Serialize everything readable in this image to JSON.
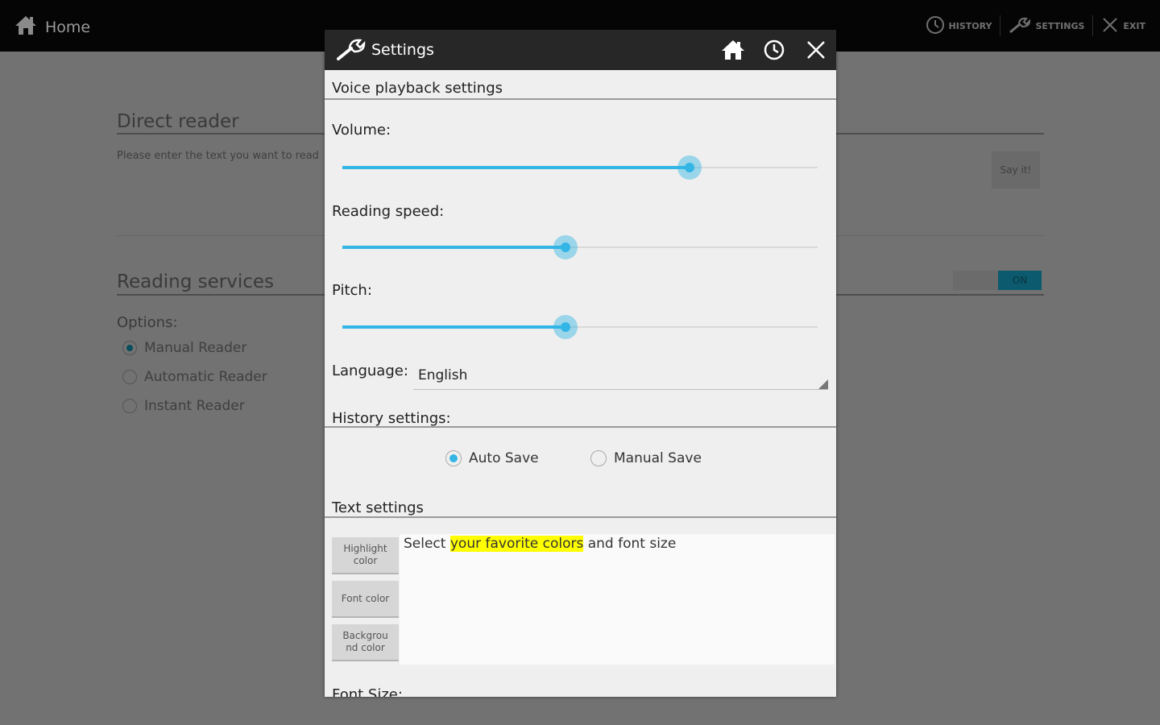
{
  "topbar": {
    "home_label": "Home",
    "actions": [
      {
        "label": "HISTORY",
        "icon": "clock-icon"
      },
      {
        "label": "SETTINGS",
        "icon": "wrench-icon"
      },
      {
        "label": "EXIT",
        "icon": "close-icon"
      }
    ]
  },
  "background": {
    "direct_reader": {
      "title": "Direct reader",
      "hint": "Please enter the text you want to read",
      "say_button": "Say it!"
    },
    "reading_services": {
      "title": "Reading services",
      "toggle": "ON",
      "options_label": "Options:",
      "options": [
        {
          "label": "Manual Reader",
          "selected": true
        },
        {
          "label": "Automatic Reader",
          "selected": false
        },
        {
          "label": "Instant Reader",
          "selected": false
        }
      ]
    }
  },
  "dialog": {
    "title": "Settings",
    "header_icons": [
      "home-icon",
      "clock-icon",
      "close-icon"
    ],
    "voice": {
      "section_title": "Voice playback settings",
      "volume_label": "Volume:",
      "volume_value": 0.73,
      "speed_label": "Reading speed:",
      "speed_value": 0.47,
      "pitch_label": "Pitch:",
      "pitch_value": 0.47,
      "language_label": "Language:",
      "language_value": "English"
    },
    "history": {
      "section_title": "History settings:",
      "options": [
        {
          "label": "Auto Save",
          "selected": true
        },
        {
          "label": "Manual Save",
          "selected": false
        }
      ]
    },
    "text": {
      "section_title": "Text settings",
      "buttons": [
        "Highlight color",
        "Font color",
        "Backgrou nd color"
      ],
      "preview_before": "Select ",
      "preview_highlight": "your favorite colors",
      "preview_after": " and font size",
      "highlight_color": "#ffff00"
    },
    "font_size_label": "Font Size:"
  },
  "colors": {
    "accent": "#33b5e5",
    "header": "#272727",
    "topbar": "#050505",
    "dim_background": "#727272"
  }
}
